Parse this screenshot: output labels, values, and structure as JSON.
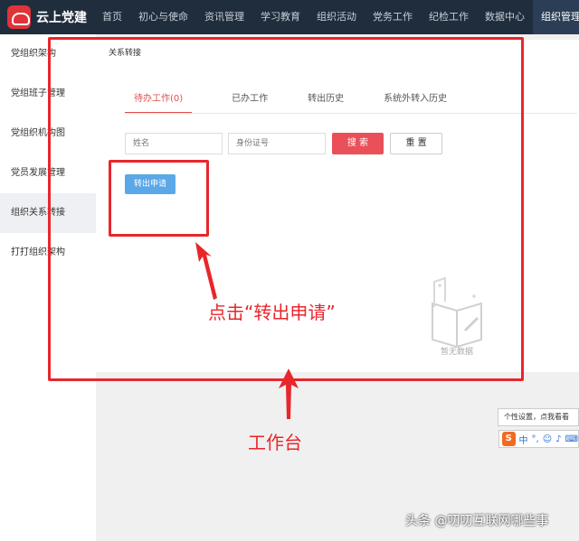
{
  "app": {
    "logo_text": "云上党建"
  },
  "nav": {
    "items": [
      "首页",
      "初心与使命",
      "资讯管理",
      "学习教育",
      "组织活动",
      "党务工作",
      "纪检工作",
      "数据中心",
      "组织管理"
    ],
    "active_index": 8
  },
  "sidebar": {
    "items": [
      "党组织架构",
      "党组班子管理",
      "党组织机构图",
      "党员发展管理",
      "组织关系转接",
      "打打组织架构"
    ],
    "active_index": 4
  },
  "breadcrumb": {
    "title": "关系转接"
  },
  "tabs": [
    {
      "label": "待办工作(0)"
    },
    {
      "label": "已办工作"
    },
    {
      "label": "转出历史"
    },
    {
      "label": "系统外转入历史"
    }
  ],
  "search": {
    "name_placeholder": "姓名",
    "id_placeholder": "身份证号",
    "search_label": "搜 索",
    "reset_label": "重 置"
  },
  "actions": {
    "transfer_label": "转出申请"
  },
  "empty": {
    "text": "暂无数据"
  },
  "annotations": {
    "click_text": "点击“转出申请”",
    "workbench_text": "工作台",
    "color": "#e8262b"
  },
  "tooltip": {
    "text": "个性设置，点我看看"
  },
  "ime": {
    "logo": "S",
    "items": [
      "中",
      "°,",
      "☺",
      "♪",
      "⌨"
    ]
  },
  "watermark": {
    "text": "头条 @叨叨互联网哪些事"
  }
}
